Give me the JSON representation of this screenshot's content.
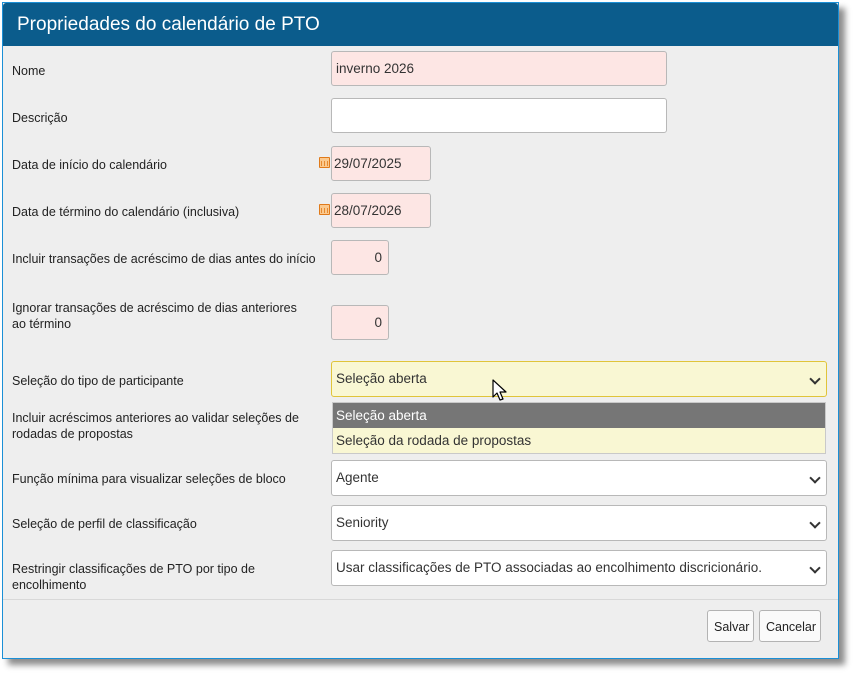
{
  "dialog": {
    "title": "Propriedades do calendário de PTO"
  },
  "fields": {
    "nome": {
      "label": "Nome",
      "value": "inverno 2026"
    },
    "descricao": {
      "label": "Descrição",
      "value": ""
    },
    "data_inicio": {
      "label": "Data de início do calendário",
      "value": "29/07/2025"
    },
    "data_termino": {
      "label": "Data de término do calendário (inclusiva)",
      "value": "28/07/2026"
    },
    "incluir_dias": {
      "label": "Incluir transações de acréscimo de dias antes do início",
      "value": "0"
    },
    "ignorar_dias": {
      "label": "Ignorar transações de acréscimo de dias anteriores ao término",
      "value": "0"
    },
    "tipo_participante": {
      "label": "Seleção do tipo de participante",
      "value": "Seleção aberta"
    },
    "incluir_acrescimos": {
      "label": "Incluir acréscimos anteriores ao validar seleções de rodadas de propostas"
    },
    "funcao_minima": {
      "label": "Função mínima para visualizar seleções de bloco",
      "value": "Agente"
    },
    "perfil_classificacao": {
      "label": "Seleção de perfil de classificação",
      "value": "Seniority"
    },
    "restringir": {
      "label": "Restringir classificações de PTO por tipo de encolhimento",
      "value": "Usar classificações de PTO associadas ao encolhimento discricionário."
    }
  },
  "dropdown": {
    "options": [
      "Seleção aberta",
      "Seleção da rodada de propostas"
    ],
    "selected_index": 0
  },
  "buttons": {
    "save": "Salvar",
    "cancel": "Cancelar"
  },
  "icons": {
    "calendar": "calendar-icon",
    "chevron": "chevron-down-icon",
    "cursor": "mouse-pointer-icon"
  },
  "colors": {
    "titlebar": "#0b5c8c",
    "required_field": "#fde6e4",
    "open_select": "#f9f7d3",
    "selected_option": "#767676"
  }
}
